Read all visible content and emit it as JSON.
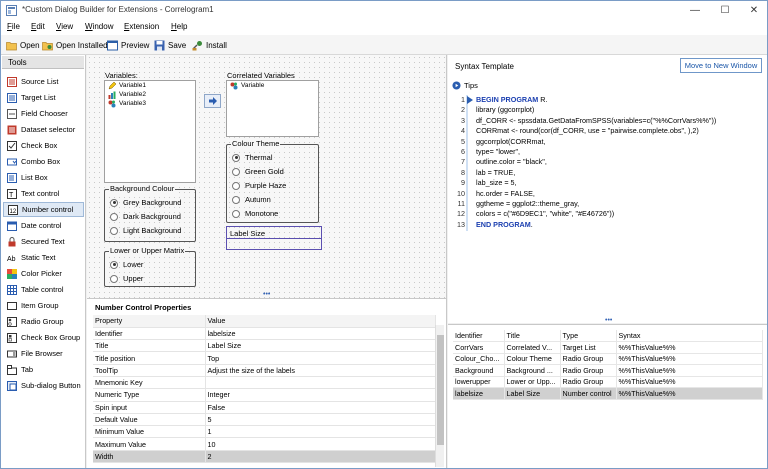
{
  "window": {
    "title": "*Custom Dialog Builder for Extensions - Correlogram1",
    "controls": [
      "—",
      "☐",
      "✕"
    ]
  },
  "menu": [
    {
      "underline": "F",
      "rest": "ile"
    },
    {
      "underline": "E",
      "rest": "dit"
    },
    {
      "underline": "V",
      "rest": "iew"
    },
    {
      "underline": "W",
      "rest": "indow"
    },
    {
      "underline": "E",
      "rest": "xtension"
    },
    {
      "underline": "H",
      "rest": "elp"
    }
  ],
  "toolbar": {
    "open": "Open",
    "open_installed": "Open Installed",
    "preview": "Preview",
    "save": "Save",
    "install": "Install"
  },
  "tools": {
    "header": "Tools",
    "items": [
      "Source List",
      "Target List",
      "Field Chooser",
      "Dataset selector",
      "Check Box",
      "Combo Box",
      "List Box",
      "Text control",
      "Number control",
      "Date control",
      "Secured Text",
      "Static Text",
      "Color Picker",
      "Table control",
      "Item Group",
      "Radio Group",
      "Check Box Group",
      "File Browser",
      "Tab",
      "Sub-dialog Button"
    ],
    "selected_index": 8
  },
  "canvas": {
    "variables_label": "Variables:",
    "variables": [
      "Variable1",
      "Variable2",
      "Variable3"
    ],
    "correlated_label": "Correlated Variables",
    "correlated_items": [
      "Variable"
    ],
    "background_colour": {
      "title": "Background Colour",
      "options": [
        "Grey Background",
        "Dark Background",
        "Light Background"
      ],
      "selected": 0
    },
    "lower_upper": {
      "title": "Lower or Upper Matrix",
      "options": [
        "Lower",
        "Upper"
      ],
      "selected": 0
    },
    "colour_theme": {
      "title": "Colour Theme",
      "options": [
        "Thermal",
        "Green Gold",
        "Purple Haze",
        "Autumn",
        "Monotone"
      ],
      "selected": 0
    },
    "label_size": {
      "label": "Label Size",
      "value": ""
    }
  },
  "properties": {
    "title": "Number Control Properties",
    "headers": [
      "Property",
      "Value"
    ],
    "rows": [
      [
        "Identifier",
        "labelsize"
      ],
      [
        "Title",
        "Label Size"
      ],
      [
        "Title position",
        "Top"
      ],
      [
        "ToolTip",
        "Adjust the size of the labels"
      ],
      [
        "Mnemonic Key",
        ""
      ],
      [
        "Numeric Type",
        "Integer"
      ],
      [
        "Spin input",
        "False"
      ],
      [
        "Default Value",
        "5"
      ],
      [
        "Minimum Value",
        "1"
      ],
      [
        "Maximum Value",
        "10"
      ],
      [
        "Width",
        "2"
      ]
    ],
    "highlighted_row": 10
  },
  "syntax": {
    "title": "Syntax Template",
    "new_window_button": "Move to New Window",
    "tips_label": "Tips",
    "lines": [
      {
        "num": "1",
        "keyword": "BEGIN PROGRAM",
        "text": " R."
      },
      {
        "num": "2",
        "keyword": "",
        "text": "library (ggcorrplot)"
      },
      {
        "num": "3",
        "keyword": "",
        "text": "df_CORR <- spssdata.GetDataFromSPSS(variables=c(\"%%CorrVars%%\"))"
      },
      {
        "num": "4",
        "keyword": "",
        "text": "CORRmat <- round(cor(df_CORR,  use = \"pairwise.complete.obs\", ),2)"
      },
      {
        "num": "5",
        "keyword": "",
        "text": "ggcorrplot(CORRmat,"
      },
      {
        "num": "6",
        "keyword": "",
        "text": "type= \"lower\","
      },
      {
        "num": "7",
        "keyword": "",
        "text": "outline.color = \"black\","
      },
      {
        "num": "8",
        "keyword": "",
        "text": "lab = TRUE,"
      },
      {
        "num": "9",
        "keyword": "",
        "text": "lab_size = 5,"
      },
      {
        "num": "10",
        "keyword": "",
        "text": "hc.order = FALSE,"
      },
      {
        "num": "11",
        "keyword": "",
        "text": "ggtheme = ggplot2::theme_gray,"
      },
      {
        "num": "12",
        "keyword": "",
        "text": "colors = c(\"#6D9EC1\", \"white\", \"#E46726\"))"
      },
      {
        "num": "13",
        "keyword": "END PROGRAM",
        "text": "."
      }
    ]
  },
  "identifiers": {
    "headers": [
      "Identifier",
      "Title",
      "Type",
      "Syntax"
    ],
    "rows": [
      [
        "CorrVars",
        "Correlated V...",
        "Target List",
        "%%ThisValue%%"
      ],
      [
        "Colour_Cho...",
        "Colour Theme",
        "Radio Group",
        "%%ThisValue%%"
      ],
      [
        "Background",
        "Background ...",
        "Radio Group",
        "%%ThisValue%%"
      ],
      [
        "lowerupper",
        "Lower or Upp...",
        "Radio Group",
        "%%ThisValue%%"
      ],
      [
        "labelsize",
        "Label Size",
        "Number control",
        "%%ThisValue%%"
      ]
    ],
    "highlighted_row": 4
  },
  "colors": {
    "accent": "#1b3fb0",
    "selection": "#d0d0d0",
    "border": "#7a9cc6"
  }
}
